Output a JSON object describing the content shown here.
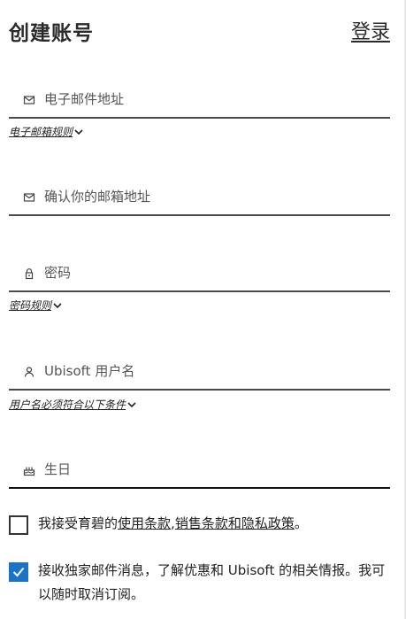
{
  "header": {
    "title": "创建账号",
    "login_link": "登录"
  },
  "fields": {
    "email": {
      "placeholder": "电子邮件地址",
      "icon": "mail-icon"
    },
    "email_confirm": {
      "placeholder": "确认你的邮箱地址",
      "icon": "mail-icon"
    },
    "password": {
      "placeholder": "密码",
      "icon": "lock-icon"
    },
    "username": {
      "placeholder": "Ubisoft 用户名",
      "icon": "user-icon"
    },
    "birthday": {
      "placeholder": "生日",
      "icon": "cake-icon"
    }
  },
  "rules": {
    "email_rules": "电子邮箱规则",
    "password_rules": "密码规则",
    "username_rules": "用户名必须符合以下条件"
  },
  "terms": {
    "checked": false,
    "prefix": "我接受育碧的",
    "terms_of_use": "使用条款",
    "comma": ",",
    "terms_of_sale": "销售条款",
    "and": "和",
    "privacy_policy": "隐私政策",
    "suffix": "。"
  },
  "newsletter": {
    "checked": true,
    "text": "接收独家邮件消息，了解优惠和 Ubisoft 的相关情报。我可以随时取消订阅。"
  },
  "colors": {
    "accent": "#1a73c9",
    "text": "#1f1f1f",
    "underline": "#4a4a4a"
  }
}
